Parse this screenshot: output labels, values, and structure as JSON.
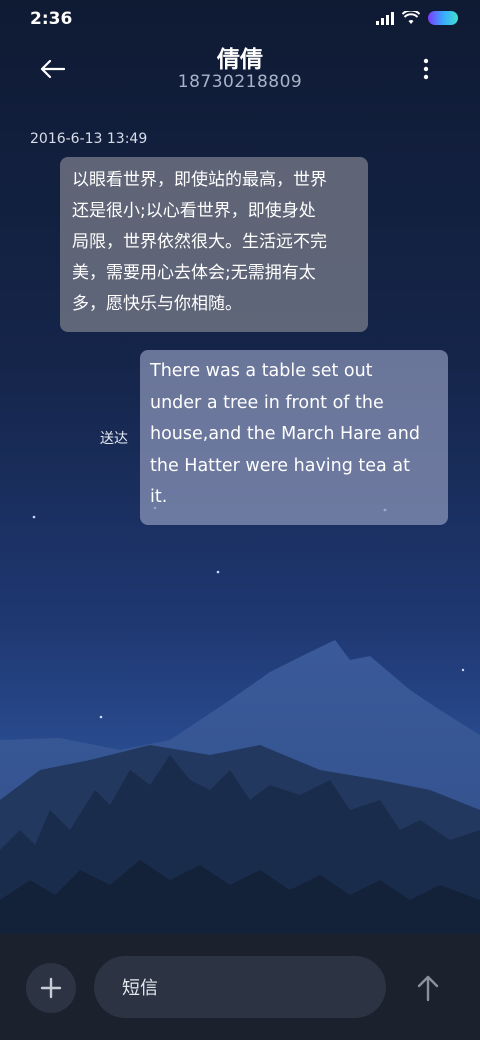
{
  "status_bar": {
    "time": "2:36"
  },
  "header": {
    "contact_name": "倩倩",
    "phone_number": "18730218809"
  },
  "conversation": {
    "timestamp": "2016-6-13 13:49",
    "incoming": {
      "lines": [
        "以眼看世界，即使站的最高，世界",
        "还是很小;以心看世界，即使身处",
        "局限，世界依然很大。生活远不完",
        "美，需要用心去体会;无需拥有太",
        "多，愿快乐与你相随。"
      ]
    },
    "outgoing": {
      "status": "送达",
      "lines": [
        "There was a table set out",
        "under a tree in front of the",
        "house,and the March Hare and",
        "the Hatter were having tea at",
        "it."
      ]
    }
  },
  "composer": {
    "placeholder": "短信"
  },
  "icons": {
    "back": "arrow-left-icon",
    "more": "more-vertical-icon",
    "add": "plus-icon",
    "send": "arrow-up-icon",
    "signal": "signal-icon",
    "wifi": "wifi-icon",
    "battery": "battery-icon"
  },
  "colors": {
    "bubble_in": "#7d808c",
    "bubble_out": "#8c96b9",
    "bottom_bar": "#1b212d",
    "input_bg": "#2c3342"
  }
}
